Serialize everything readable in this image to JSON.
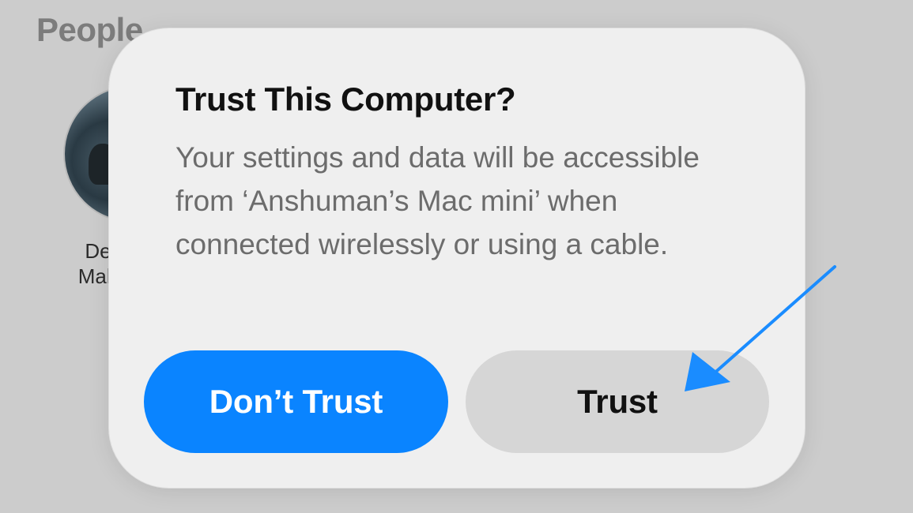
{
  "background": {
    "section_title": "People",
    "contact": {
      "name_line1": "De",
      "name_line2": "Mah"
    }
  },
  "dialog": {
    "title": "Trust This Computer?",
    "message": "Your settings and data will be accessible from ‘Anshuman’s Mac mini’ when connected wirelessly or using a cable.",
    "buttons": {
      "dont_trust": "Don’t Trust",
      "trust": "Trust"
    }
  },
  "colors": {
    "primary_button": "#0a84ff",
    "secondary_button": "#d6d6d6",
    "annotation_arrow": "#1a8cff"
  },
  "annotation": {
    "arrow_icon": "arrow-pointing-to-trust-button"
  }
}
